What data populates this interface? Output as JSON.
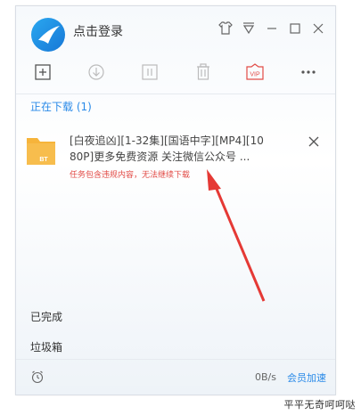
{
  "app": {
    "login_text": "点击登录",
    "section_title": "正在下载 (1)",
    "completed_label": "已完成",
    "trash_label": "垃圾箱",
    "speed": "0B/s",
    "vip_accel": "会员加速"
  },
  "toolbar": {
    "buttons": [
      "new-task",
      "start",
      "pause",
      "delete",
      "vip",
      "more"
    ],
    "vip_label": "VIP"
  },
  "download_item": {
    "badge": "BT",
    "name_line1": "[白夜追凶][1-32集][国语中字][MP4][10",
    "name_line2": "80P]更多免费资源 关注微信公众号 ...",
    "error": "任务包含违规内容，无法继续下载"
  },
  "watermark": "平平无奇呵呵哒",
  "colors": {
    "accent": "#2a8ae8",
    "error": "#e24b46",
    "folder": "#f6b43b",
    "arrow": "#e53935"
  }
}
